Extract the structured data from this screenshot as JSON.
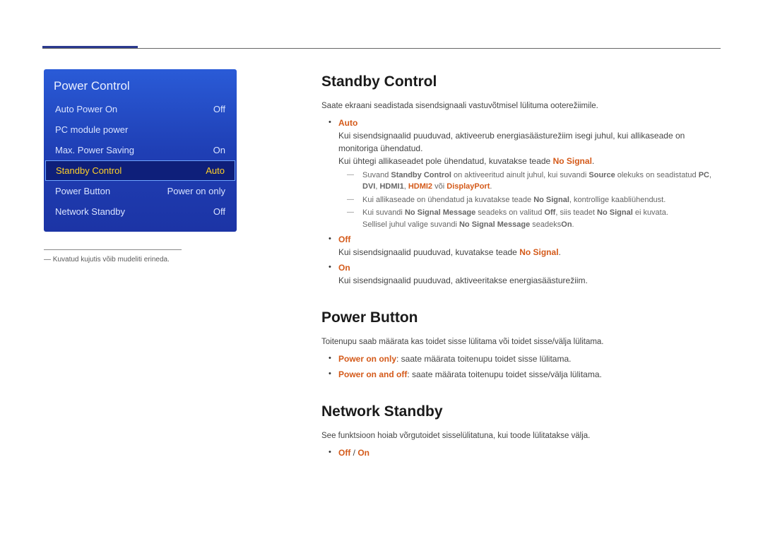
{
  "menu": {
    "title": "Power Control",
    "items": [
      {
        "label": "Auto Power On",
        "value": "Off"
      },
      {
        "label": "PC module power",
        "value": ""
      },
      {
        "label": "Max. Power Saving",
        "value": "On"
      },
      {
        "label": "Standby Control",
        "value": "Auto"
      },
      {
        "label": "Power Button",
        "value": "Power on only"
      },
      {
        "label": "Network Standby",
        "value": "Off"
      }
    ]
  },
  "footnote": "― Kuvatud kujutis võib mudeliti erineda.",
  "sections": {
    "standby": {
      "title": "Standby Control",
      "intro": "Saate ekraani seadistada sisendsignaali vastuvõtmisel lülituma ooterežiimile.",
      "auto": {
        "label": "Auto",
        "line1": "Kui sisendsignaalid puuduvad, aktiveerub energiasäästurežiim isegi juhul, kui allikaseade on monitoriga ühendatud.",
        "line2_a": "Kui ühtegi allikaseadet pole ühendatud, kuvatakse teade ",
        "line2_b": "No Signal",
        "line2_c": ".",
        "dash1_a": "Suvand ",
        "dash1_b": "Standby Control",
        "dash1_c": " on aktiveeritud ainult juhul, kui suvandi ",
        "dash1_d": "Source",
        "dash1_e": " olekuks on seadistatud ",
        "dash1_f": "PC",
        "dash1_g": ", ",
        "dash1_h": "DVI",
        "dash1_i": ", ",
        "dash1_j": "HDMI1",
        "dash1_k": ", ",
        "dash1_l": "HDMI2",
        "dash1_m": " või ",
        "dash1_n": "DisplayPort",
        "dash1_o": ".",
        "dash2_a": "Kui allikaseade on ühendatud ja kuvatakse teade ",
        "dash2_b": "No Signal",
        "dash2_c": ", kontrollige kaabliühendust.",
        "dash3_a": "Kui suvandi ",
        "dash3_b": "No Signal Message",
        "dash3_c": " seadeks on valitud ",
        "dash3_d": "Off",
        "dash3_e": ", siis teadet ",
        "dash3_f": "No Signal",
        "dash3_g": " ei kuvata.",
        "dash3_line2_a": "Sellisel juhul valige suvandi ",
        "dash3_line2_b": "No Signal Message",
        "dash3_line2_c": " seadeks",
        "dash3_line2_d": "On",
        "dash3_line2_e": "."
      },
      "off": {
        "label": "Off",
        "line_a": "Kui sisendsignaalid puuduvad, kuvatakse teade ",
        "line_b": "No Signal",
        "line_c": "."
      },
      "on": {
        "label": "On",
        "line": "Kui sisendsignaalid puuduvad, aktiveeritakse energiasäästurežiim."
      }
    },
    "power_button": {
      "title": "Power Button",
      "intro": "Toitenupu saab määrata kas toidet sisse lülitama või toidet sisse/välja lülitama.",
      "b1_a": "Power on only",
      "b1_b": ": saate määrata toitenupu toidet sisse lülitama.",
      "b2_a": "Power on and off",
      "b2_b": ": saate määrata toitenupu toidet sisse/välja lülitama."
    },
    "network": {
      "title": "Network Standby",
      "intro": "See funktsioon hoiab võrgutoidet sisselülitatuna, kui toode lülitatakse välja.",
      "opt_off": "Off",
      "opt_sep": " / ",
      "opt_on": "On"
    }
  }
}
